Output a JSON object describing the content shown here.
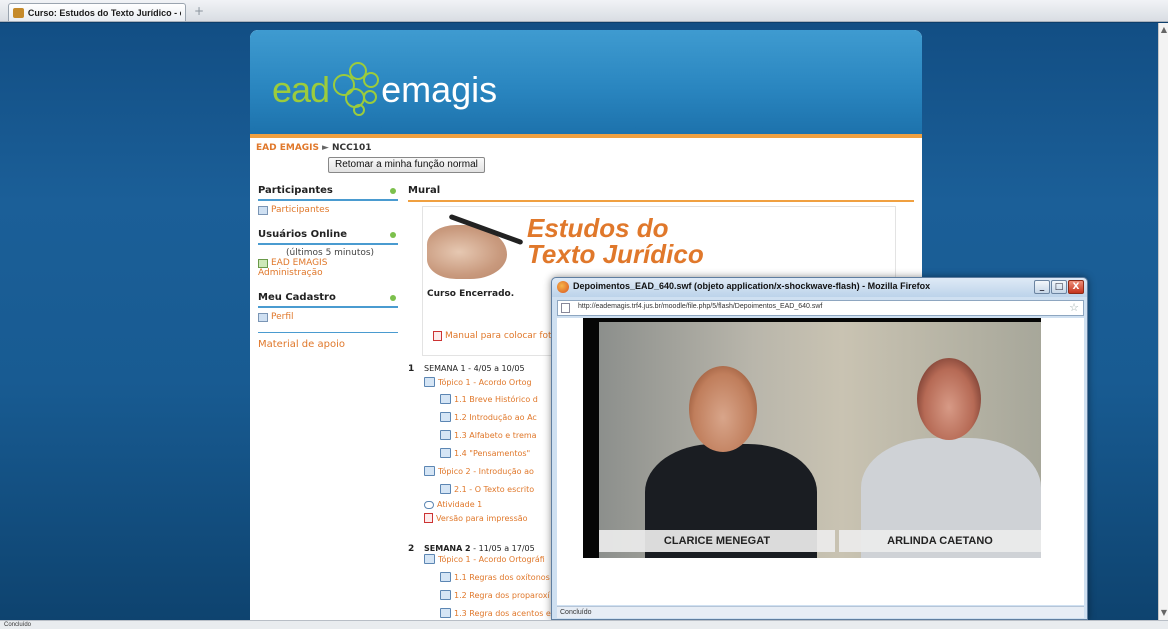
{
  "browser": {
    "tab_title": "Curso: Estudos do Texto Jurídico - en...",
    "new_tab_symbol": "+",
    "status": "Concluído"
  },
  "site": {
    "logo_ead": "ead",
    "logo_emagis": "emagis",
    "accent_color": "#e0782b",
    "header_color": "#2a86c0"
  },
  "breadcrumb": {
    "home": "EAD EMAGIS",
    "separator": "►",
    "course": "NCC101"
  },
  "role_button": "Retomar a minha função normal",
  "sidebar": {
    "participantes": {
      "title": "Participantes",
      "link": "Participantes"
    },
    "online": {
      "title": "Usuários Online",
      "note": "(últimos 5 minutos)",
      "users": [
        "EAD EMAGIS",
        "Administração"
      ]
    },
    "cadastro": {
      "title": "Meu Cadastro",
      "link": "Perfil"
    },
    "material": "Material de apoio"
  },
  "main": {
    "mural": "Mural",
    "banner": {
      "line1": "Estudos do",
      "line2": "Texto Jurídico"
    },
    "status": "Curso Encerrado.",
    "manual": "Manual para colocar foto",
    "week1": {
      "num": "1",
      "title": "SEMANA 1 - 4/05 a 10/05",
      "items": [
        "Tópico 1 - Acordo Ortog",
        "1.1 Breve Histórico d",
        "1.2 Introdução ao Ac",
        "1.3 Alfabeto e trema",
        "1.4 \"Pensamentos\"",
        "Tópico 2 - Introdução ao",
        "2.1 - O Texto escrito",
        "Atividade 1",
        "Versão para impressão"
      ]
    },
    "week2": {
      "num": "2",
      "title_bold": "SEMANA 2",
      "title_rest": " - 11/05 a 17/05",
      "items": [
        "Tópico 1 - Acordo Ortográfi",
        "1.1 Regras dos oxítonos",
        "1.2 Regra dos proparoxí",
        "1.3 Regra dos acentos e"
      ]
    }
  },
  "popup": {
    "title": "Depoimentos_EAD_640.swf (objeto application/x-shockwave-flash) - Mozilla Firefox",
    "url": "http://eademagis.trf4.jus.br/moodle/file.php/5/flash/Depoimentos_EAD_640.swf",
    "caption_left": "CLARICE MENEGAT",
    "caption_right": "ARLINDA CAETANO",
    "status": "Concluído",
    "minimize": "_",
    "maximize": "□",
    "close": "X"
  },
  "icons": [
    "firefox-icon",
    "page-icon",
    "star-icon",
    "document-icon",
    "pdf-icon",
    "forum-icon",
    "participants-icon",
    "profile-icon"
  ]
}
